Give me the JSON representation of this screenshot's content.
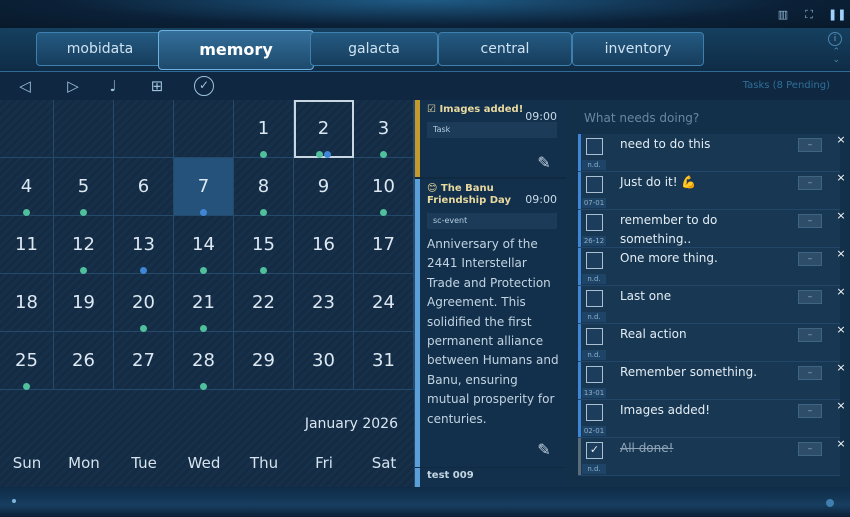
{
  "window_controls": [
    "sidebar-icon",
    "fullscreen-icon",
    "pause-icon"
  ],
  "tabs": [
    {
      "label": "mobidata"
    },
    {
      "label": "memory"
    },
    {
      "label": "galacta"
    },
    {
      "label": "central"
    },
    {
      "label": "inventory"
    }
  ],
  "toolbar": {
    "prev_icon": "◁",
    "next_icon": "▷",
    "music_icon": "♩",
    "add_icon": "⊞",
    "check_icon": "✓",
    "tasks_count": "Tasks (8 Pending)"
  },
  "calendar": {
    "month_label": "January 2026",
    "weekdays": [
      "Sun",
      "Mon",
      "Tue",
      "Wed",
      "Thu",
      "Fri",
      "Sat"
    ],
    "days": [
      {
        "n": "",
        "dots": []
      },
      {
        "n": "",
        "dots": []
      },
      {
        "n": "",
        "dots": []
      },
      {
        "n": "",
        "dots": []
      },
      {
        "n": "1",
        "dots": [
          "g"
        ]
      },
      {
        "n": "2",
        "dots": [
          "g",
          "b"
        ],
        "selected": true
      },
      {
        "n": "3",
        "dots": [
          "g"
        ]
      },
      {
        "n": "4",
        "dots": [
          "g"
        ]
      },
      {
        "n": "5",
        "dots": [
          "g"
        ]
      },
      {
        "n": "6",
        "dots": []
      },
      {
        "n": "7",
        "dots": [
          "b"
        ],
        "today": true
      },
      {
        "n": "8",
        "dots": [
          "g"
        ]
      },
      {
        "n": "9",
        "dots": []
      },
      {
        "n": "10",
        "dots": [
          "g"
        ]
      },
      {
        "n": "11",
        "dots": []
      },
      {
        "n": "12",
        "dots": [
          "g"
        ]
      },
      {
        "n": "13",
        "dots": [
          "b"
        ]
      },
      {
        "n": "14",
        "dots": [
          "g"
        ]
      },
      {
        "n": "15",
        "dots": [
          "g"
        ]
      },
      {
        "n": "16",
        "dots": []
      },
      {
        "n": "17",
        "dots": []
      },
      {
        "n": "18",
        "dots": []
      },
      {
        "n": "19",
        "dots": []
      },
      {
        "n": "20",
        "dots": [
          "g"
        ]
      },
      {
        "n": "21",
        "dots": [
          "g"
        ]
      },
      {
        "n": "22",
        "dots": []
      },
      {
        "n": "23",
        "dots": []
      },
      {
        "n": "24",
        "dots": []
      },
      {
        "n": "25",
        "dots": [
          "g"
        ]
      },
      {
        "n": "26",
        "dots": []
      },
      {
        "n": "27",
        "dots": []
      },
      {
        "n": "28",
        "dots": [
          "g"
        ]
      },
      {
        "n": "29",
        "dots": []
      },
      {
        "n": "30",
        "dots": []
      },
      {
        "n": "31",
        "dots": []
      }
    ]
  },
  "events": [
    {
      "title": "☑ Images added!",
      "time": "09:00",
      "tag": "Task",
      "bar": "#c49a2c",
      "desc": ""
    },
    {
      "title": "😊 The Banu Friendship Day",
      "time": "09:00",
      "tag": "sc-event",
      "bar": "#5a9fd8",
      "desc": "Anniversary of the 2441 Interstellar Trade and Protection Agreement. This solidified the first permanent alliance between Humans and Banu, ensuring mutual prosperity for centuries."
    },
    {
      "title": "test 009",
      "time": "",
      "tag": "",
      "bar": "#5a9fd8",
      "desc": ""
    }
  ],
  "tasks": {
    "placeholder": "What needs doing?",
    "items": [
      {
        "text": "need to do this",
        "date": "n.d.",
        "done": false
      },
      {
        "text": "Just do it! 💪",
        "date": "07-01",
        "done": false
      },
      {
        "text": "remember to do something..",
        "date": "26-12",
        "done": false
      },
      {
        "text": "One more thing.",
        "date": "n.d.",
        "done": false
      },
      {
        "text": "Last one",
        "date": "n.d.",
        "done": false
      },
      {
        "text": "Real action",
        "date": "n.d.",
        "done": false
      },
      {
        "text": "Remember something.",
        "date": "13-01",
        "done": false
      },
      {
        "text": "Images added!",
        "date": "02-01",
        "done": false
      },
      {
        "text": "All done!",
        "date": "n.d.",
        "done": true
      }
    ],
    "minus_label": "–",
    "close_label": "×",
    "check_label": "✓"
  },
  "colors": {
    "accent": "#3f86d6",
    "dot_green": "#4fc09b",
    "task_bar": "#c49a2c"
  }
}
